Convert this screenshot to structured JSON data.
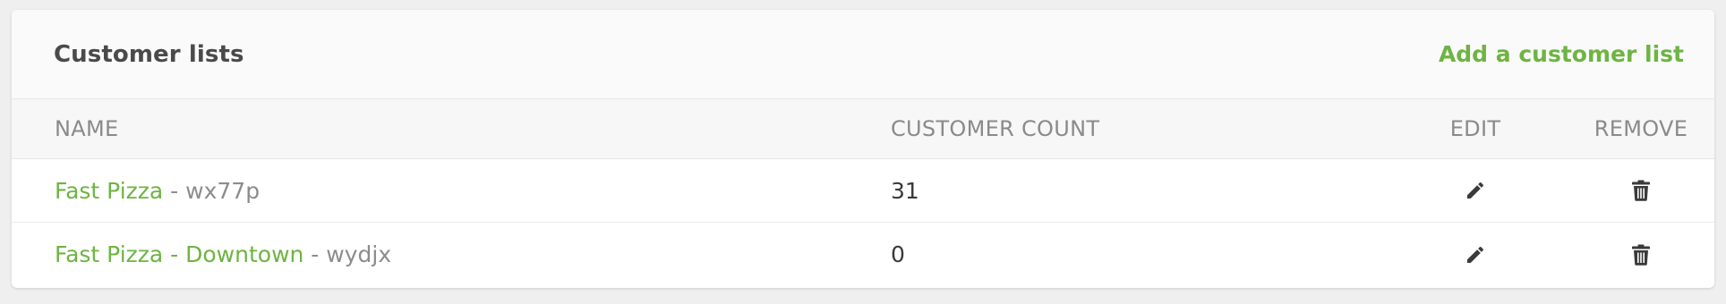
{
  "header": {
    "title": "Customer lists",
    "add_link": "Add a customer list"
  },
  "table": {
    "columns": {
      "name": "NAME",
      "count": "CUSTOMER COUNT",
      "edit": "EDIT",
      "remove": "REMOVE"
    },
    "rows": [
      {
        "name": "Fast Pizza",
        "separator": " - ",
        "code": "wx77p",
        "count": "31",
        "edit_icon": "pencil-icon",
        "remove_icon": "trash-icon"
      },
      {
        "name": "Fast Pizza - Downtown",
        "separator": " - ",
        "code": "wydjx",
        "count": "0",
        "edit_icon": "pencil-icon",
        "remove_icon": "trash-icon"
      }
    ]
  },
  "colors": {
    "accent": "#6eb442",
    "header_bg": "#fafafa",
    "table_header_bg": "#f7f7f7",
    "page_bg": "#efefef",
    "icon": "#3a3a3a"
  }
}
